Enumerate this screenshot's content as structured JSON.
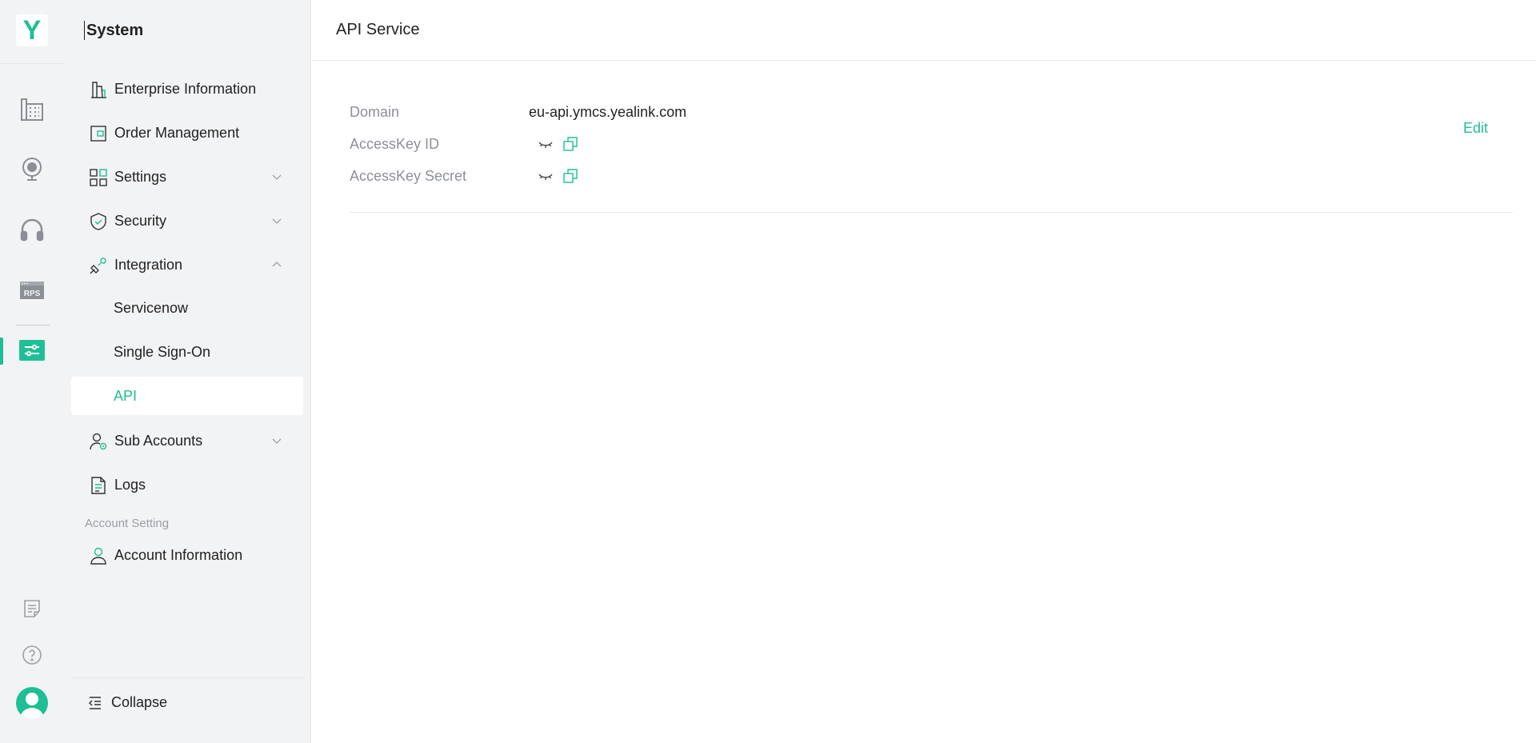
{
  "brand": {
    "logo_letter": "Y",
    "accent": "#1fbf95"
  },
  "rail": {
    "items": [
      {
        "icon": "building-grid-icon"
      },
      {
        "icon": "webcam-icon"
      },
      {
        "icon": "headset-icon"
      },
      {
        "icon": "rps-icon",
        "text": "RPS"
      },
      {
        "icon": "system-settings-icon",
        "active": true
      }
    ],
    "bottom": [
      {
        "icon": "checklist-icon"
      },
      {
        "icon": "help-icon"
      },
      {
        "icon": "avatar-icon"
      }
    ]
  },
  "sidebar": {
    "title": "System",
    "items": [
      {
        "label": "Enterprise Information",
        "icon": "building-icon"
      },
      {
        "label": "Order Management",
        "icon": "wallet-icon"
      },
      {
        "label": "Settings",
        "icon": "grid-icon",
        "chevron": "down"
      },
      {
        "label": "Security",
        "icon": "shield-icon",
        "chevron": "down"
      },
      {
        "label": "Integration",
        "icon": "plug-icon",
        "chevron": "up"
      }
    ],
    "integration_sub": [
      {
        "label": "Servicenow"
      },
      {
        "label": "Single Sign-On"
      },
      {
        "label": "API",
        "active": true
      }
    ],
    "items2": [
      {
        "label": "Sub Accounts",
        "icon": "user-gear-icon",
        "chevron": "down"
      },
      {
        "label": "Logs",
        "icon": "document-icon"
      }
    ],
    "section_label": "Account Setting",
    "account_item": {
      "label": "Account Information",
      "icon": "user-icon"
    },
    "collapse_label": "Collapse"
  },
  "main": {
    "title": "API Service",
    "fields": {
      "domain_label": "Domain",
      "domain_value": "eu-api.ymcs.yealink.com",
      "key_id_label": "AccessKey ID",
      "key_secret_label": "AccessKey Secret"
    },
    "edit_label": "Edit"
  }
}
